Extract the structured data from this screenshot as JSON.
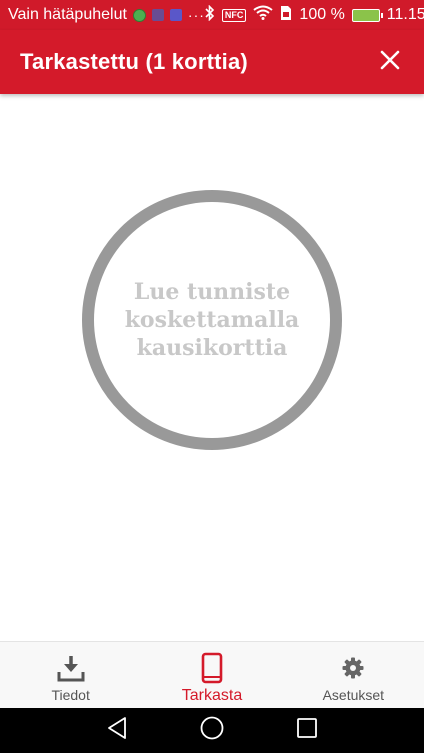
{
  "status_bar": {
    "carrier_text": "Vain hätäpuhelut",
    "dots": "···",
    "nfc_label": "NFC",
    "battery_percent": "100 %",
    "time": "11.15"
  },
  "app_bar": {
    "title": "Tarkastettu (1 korttia)"
  },
  "reader": {
    "line1": "Lue tunniste",
    "line2": "koskettamalla",
    "line3": "kausikorttia"
  },
  "bottom_nav": {
    "items": [
      {
        "label": "Tiedot",
        "icon": "download-icon",
        "active": false
      },
      {
        "label": "Tarkasta",
        "icon": "phone-icon",
        "active": true
      },
      {
        "label": "Asetukset",
        "icon": "gear-icon",
        "active": false
      }
    ]
  },
  "colors": {
    "brand_red": "#d41a2a",
    "circle_gray": "#999999",
    "text_gray": "#c8c8c8"
  }
}
